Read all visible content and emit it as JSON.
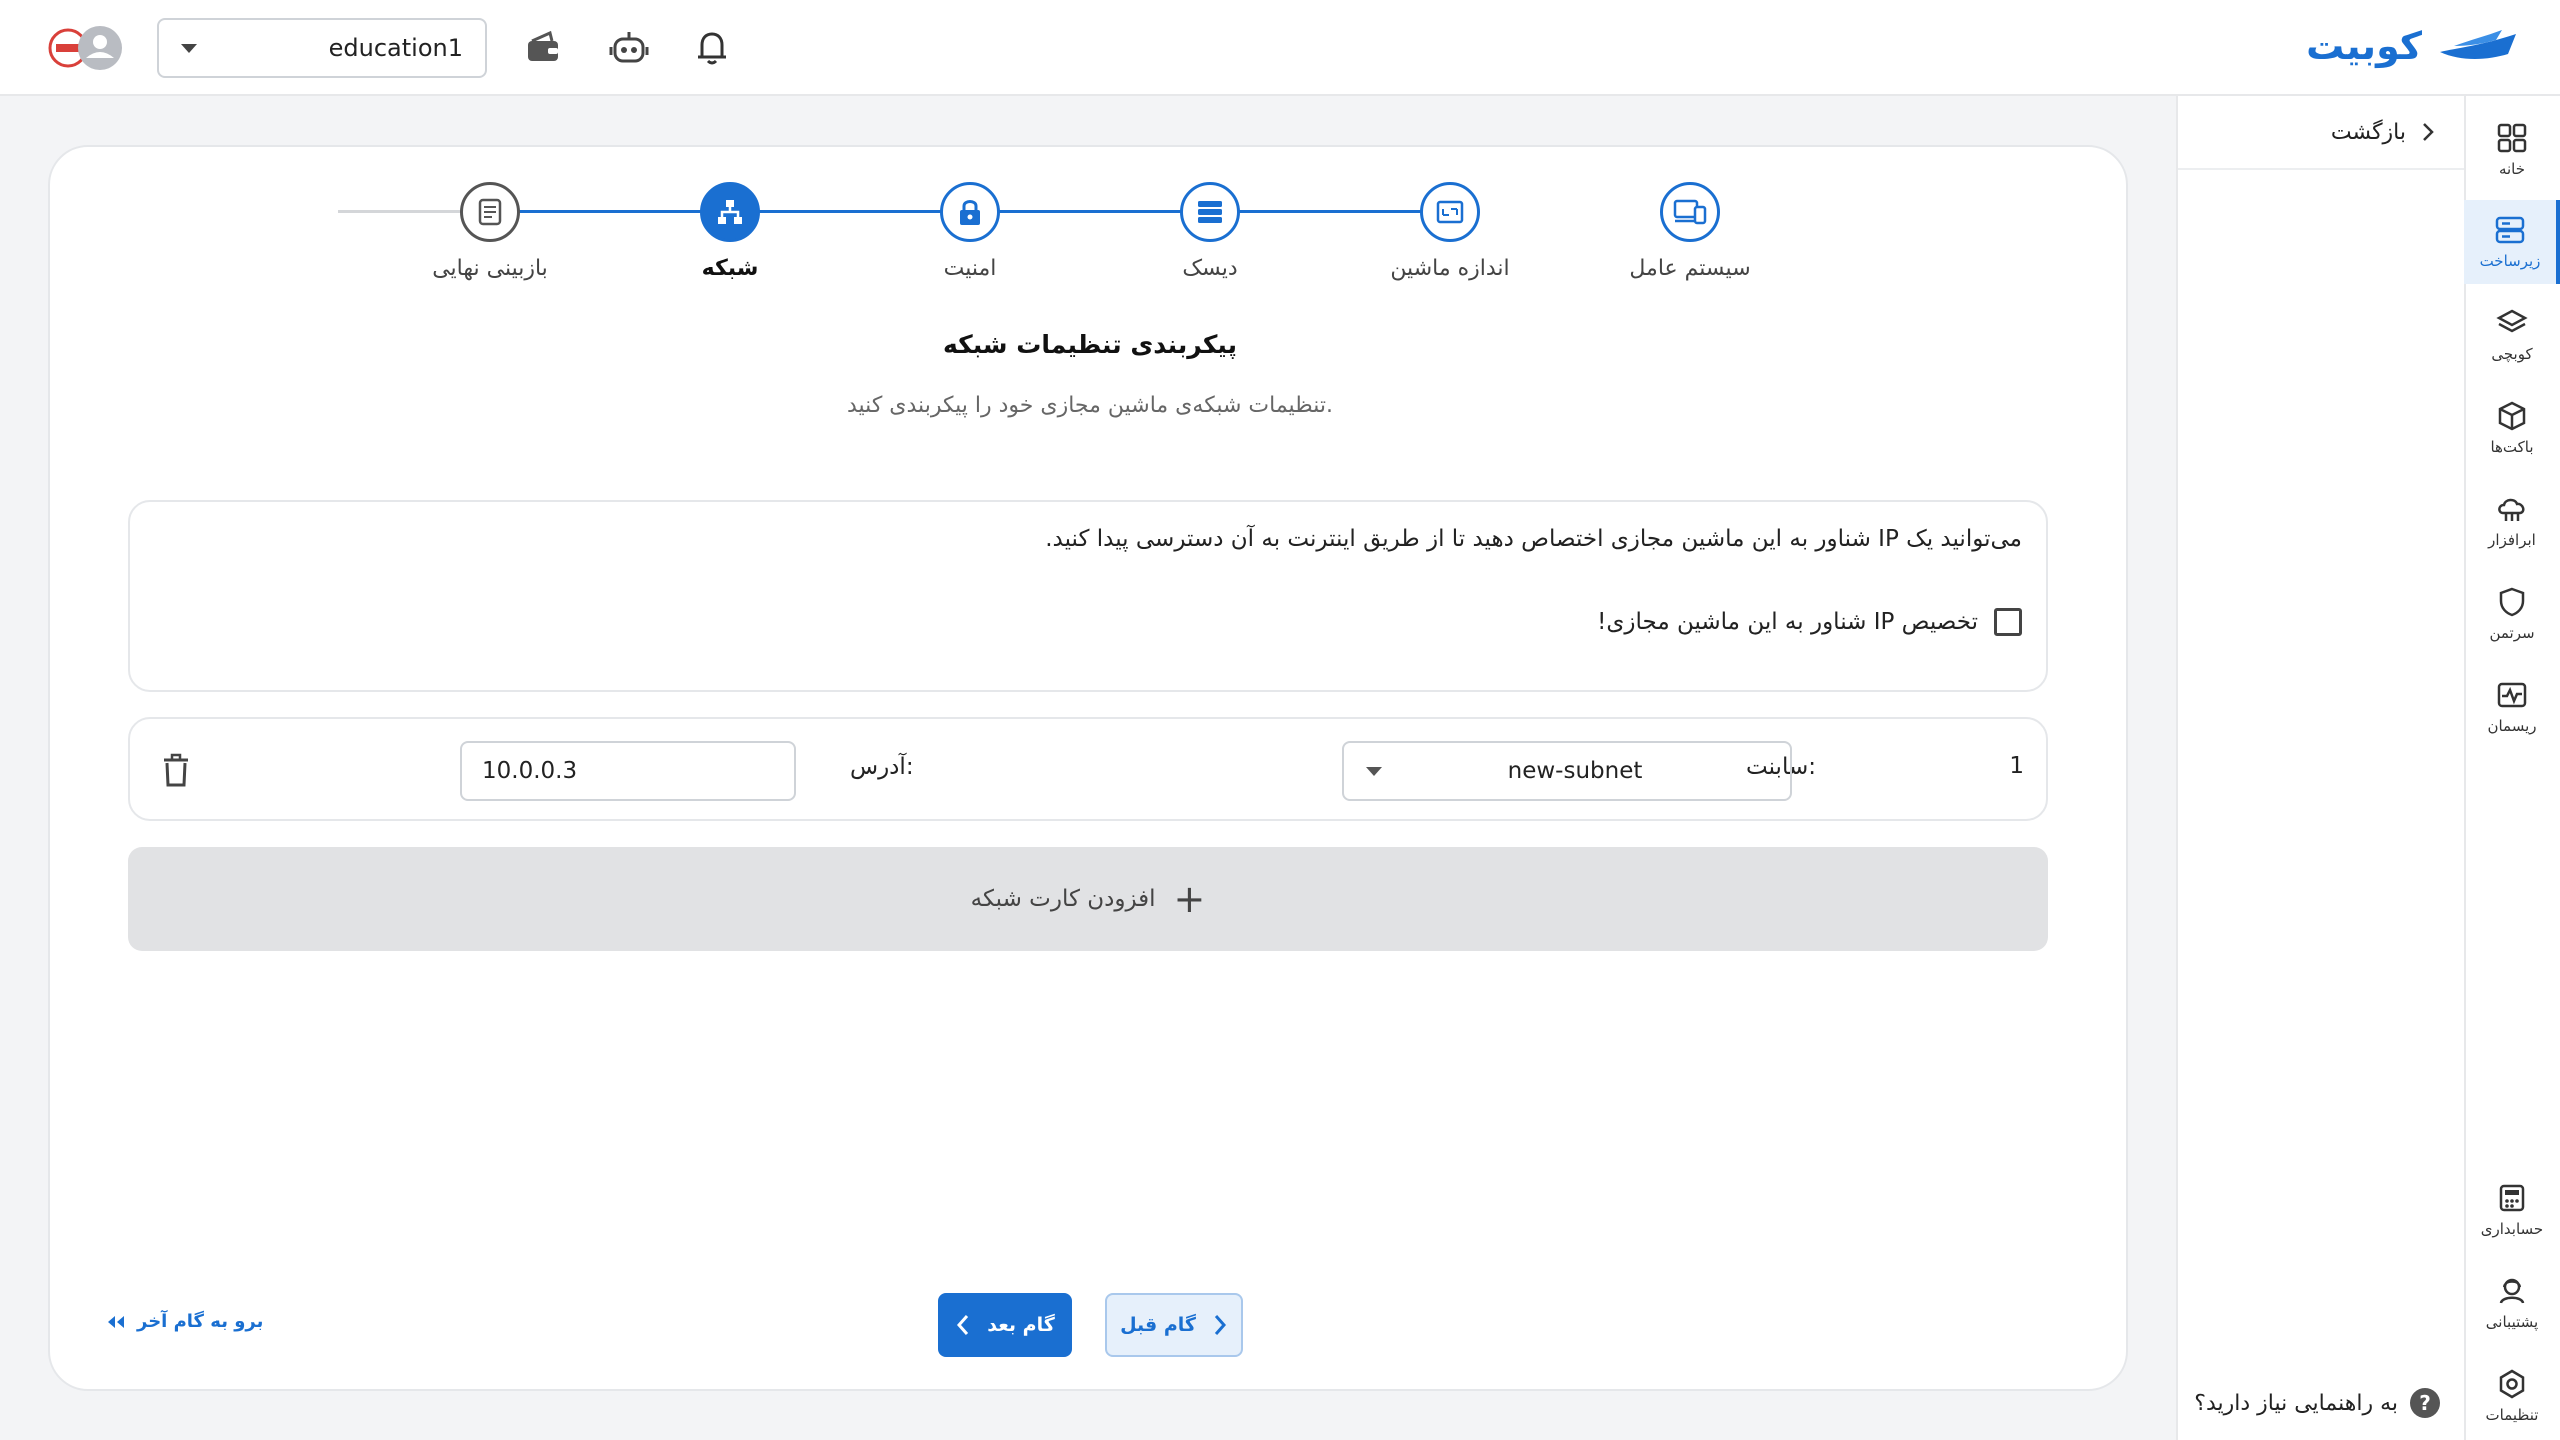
{
  "header": {
    "brand": "کوبیت",
    "org_select": "education1",
    "icons": [
      "wallet-icon",
      "robot-icon",
      "bell-icon"
    ],
    "avatar_icon": "user-avatar-icon"
  },
  "rail": {
    "items": [
      {
        "label": "خانه",
        "icon": "grid-icon"
      },
      {
        "label": "زیرساخت",
        "icon": "server-icon",
        "active": true
      },
      {
        "label": "کوبچی",
        "icon": "layers-icon"
      },
      {
        "label": "باکت‌ها",
        "icon": "box-icon"
      },
      {
        "label": "ابرافزار",
        "icon": "cloud-app-icon"
      },
      {
        "label": "سرتمن",
        "icon": "shield-icon"
      },
      {
        "label": "ریسمان",
        "icon": "pulse-icon"
      }
    ],
    "bottom_items": [
      {
        "label": "حسابداری",
        "icon": "accounting-icon"
      },
      {
        "label": "پشتیبانی",
        "icon": "support-icon"
      },
      {
        "label": "تنظیمات",
        "icon": "settings-icon"
      }
    ]
  },
  "subside": {
    "back_label": "بازگشت",
    "help_label": "به راهنمایی نیاز دارید؟",
    "help_mark": "?"
  },
  "stepper": {
    "steps": [
      {
        "label": "سیستم عامل",
        "icon": "devices-icon",
        "state": "done"
      },
      {
        "label": "اندازه ماشین",
        "icon": "resize-icon",
        "state": "done"
      },
      {
        "label": "دیسک",
        "icon": "disk-icon",
        "state": "done"
      },
      {
        "label": "امنیت",
        "icon": "lock-icon",
        "state": "done"
      },
      {
        "label": "شبکه",
        "icon": "network-icon",
        "state": "current"
      },
      {
        "label": "بازبینی نهایی",
        "icon": "review-icon",
        "state": "pending"
      }
    ]
  },
  "main": {
    "title": "پیکربندی تنظیمات شبکه",
    "subtitle": "تنظیمات شبکه‌ی ماشین مجازی خود را پیکربندی کنید.",
    "floating_ip": {
      "description": "می‌توانید یک IP شناور به این ماشین مجازی اختصاص دهید تا از طریق اینترنت به آن دسترسی پیدا کنید.",
      "checkbox_label": "تخصیص IP شناور به این ماشین مجازی!",
      "checked": false
    },
    "nic": {
      "index": "1",
      "subnet_label": "سابنت:",
      "subnet_value": "new-subnet",
      "address_label": "آدرس:",
      "address_value": "10.0.0.3"
    },
    "add_nic_label": "افزودن کارت شبکه",
    "add_nic_icon": "+"
  },
  "footer": {
    "prev_label": "گام قبل",
    "next_label": "گام بعد",
    "goto_last_label": "برو به گام آخر"
  },
  "colors": {
    "accent": "#1a6fd1",
    "accent_light": "#e6f0fb",
    "add_bg": "#e1e2e4"
  }
}
